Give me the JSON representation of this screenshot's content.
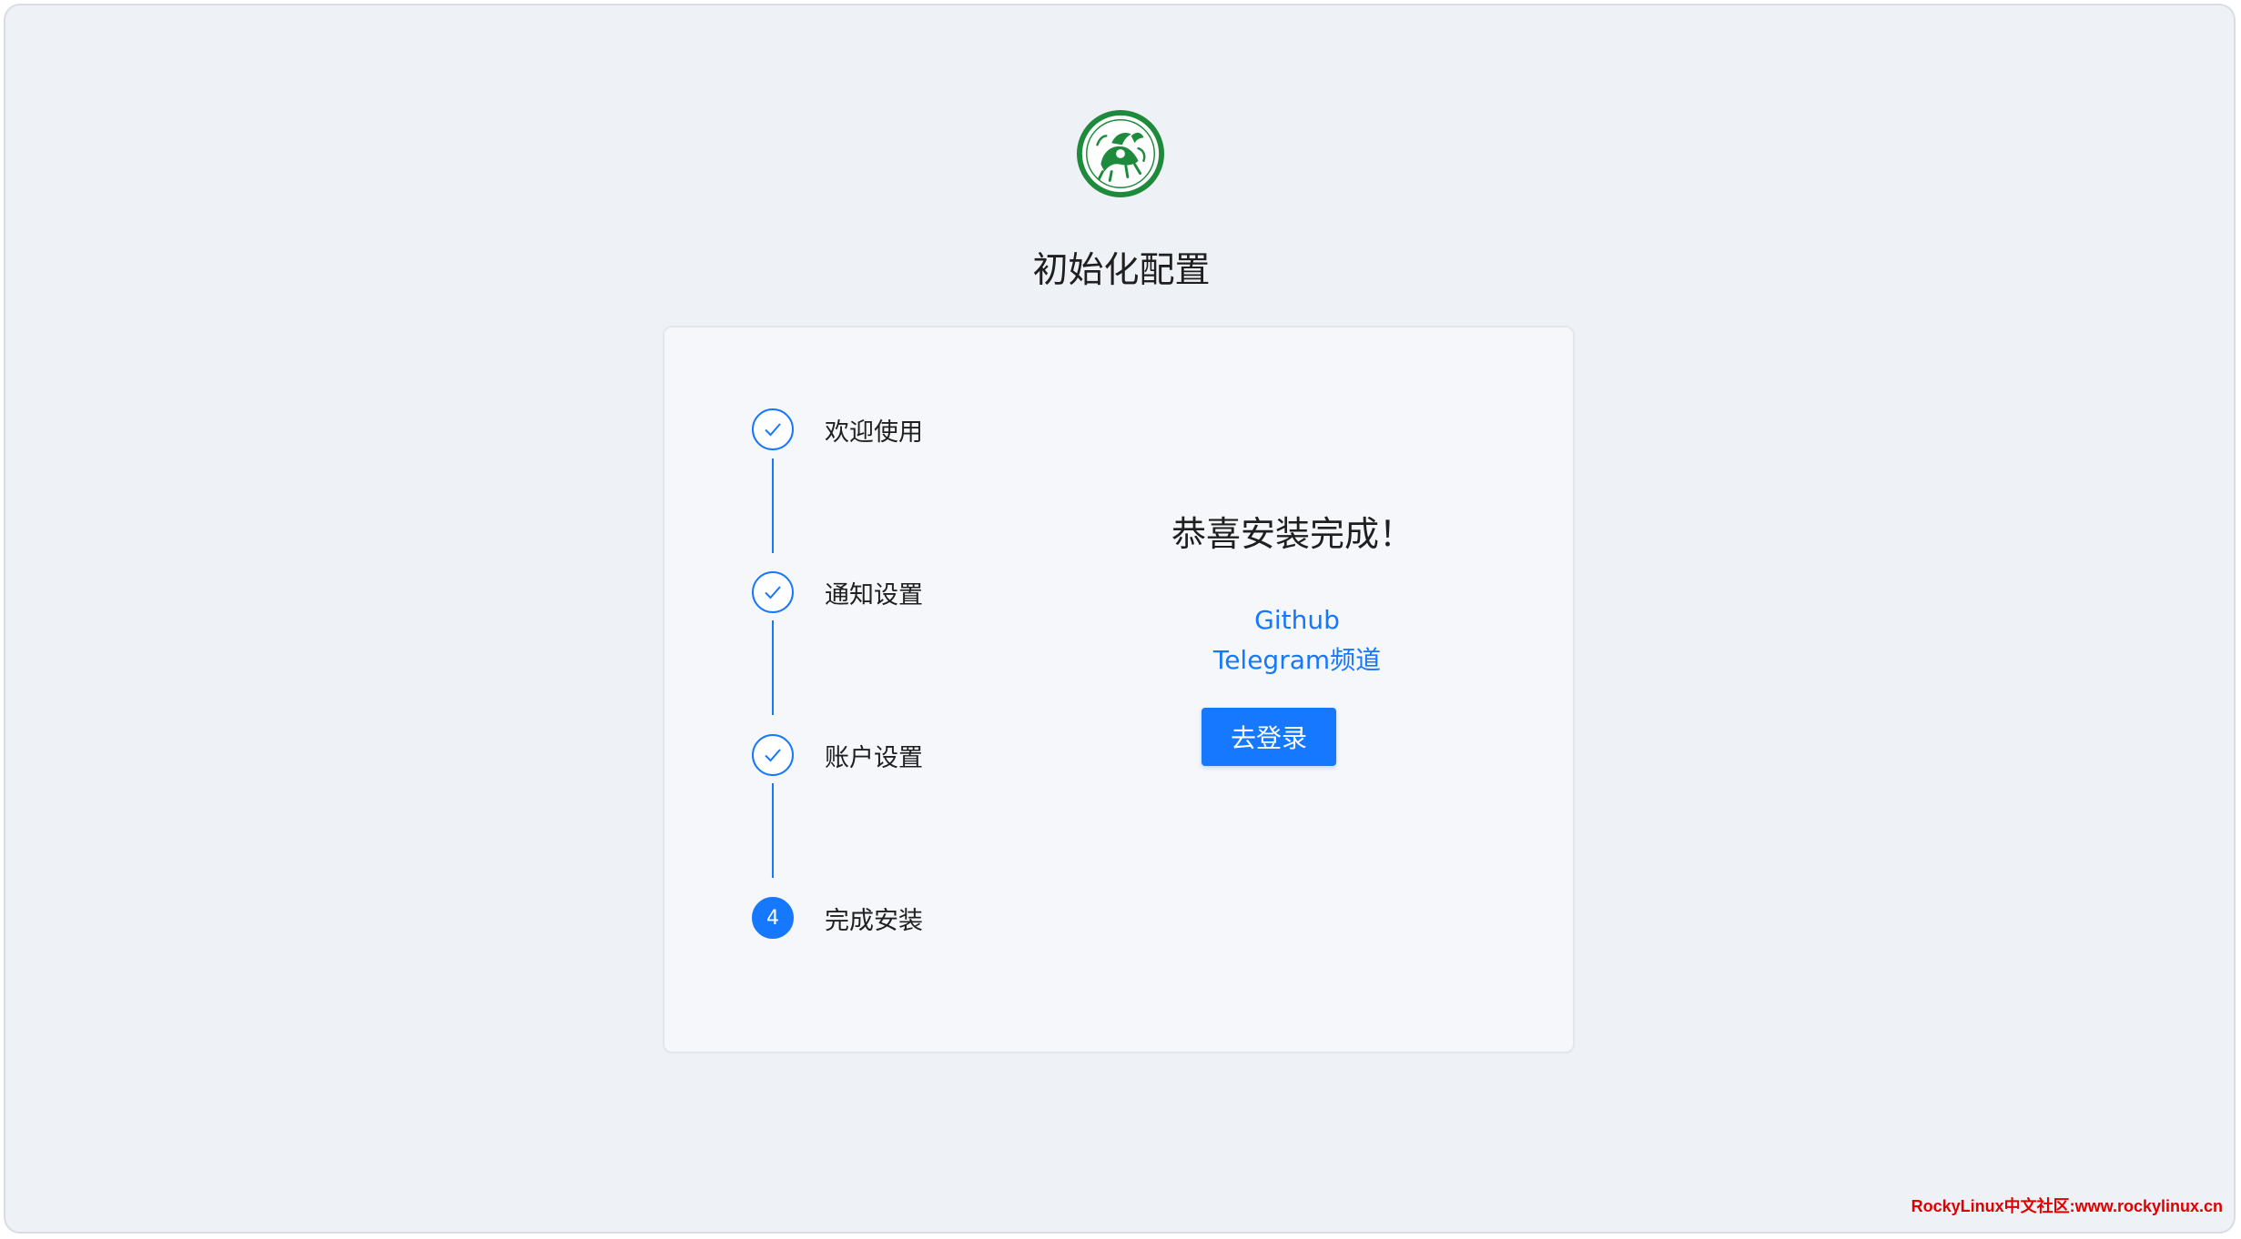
{
  "header": {
    "logo_icon": "qilin-emblem-icon",
    "title": "初始化配置"
  },
  "steps": [
    {
      "label": "欢迎使用",
      "status": "done",
      "icon": "check-icon"
    },
    {
      "label": "通知设置",
      "status": "done",
      "icon": "check-icon"
    },
    {
      "label": "账户设置",
      "status": "done",
      "icon": "check-icon"
    },
    {
      "label": "完成安装",
      "status": "current",
      "number": "4"
    }
  ],
  "result": {
    "title": "恭喜安装完成！",
    "links": [
      {
        "label": "Github"
      },
      {
        "label": "Telegram频道"
      }
    ],
    "login_button": "去登录"
  },
  "watermark": "RockyLinux中文社区:www.rockylinux.cn",
  "colors": {
    "primary": "#1677ff",
    "background": "#eef1f5",
    "card": "#f5f7fa",
    "logo_green": "#1e8a3c",
    "watermark": "#e00000"
  }
}
